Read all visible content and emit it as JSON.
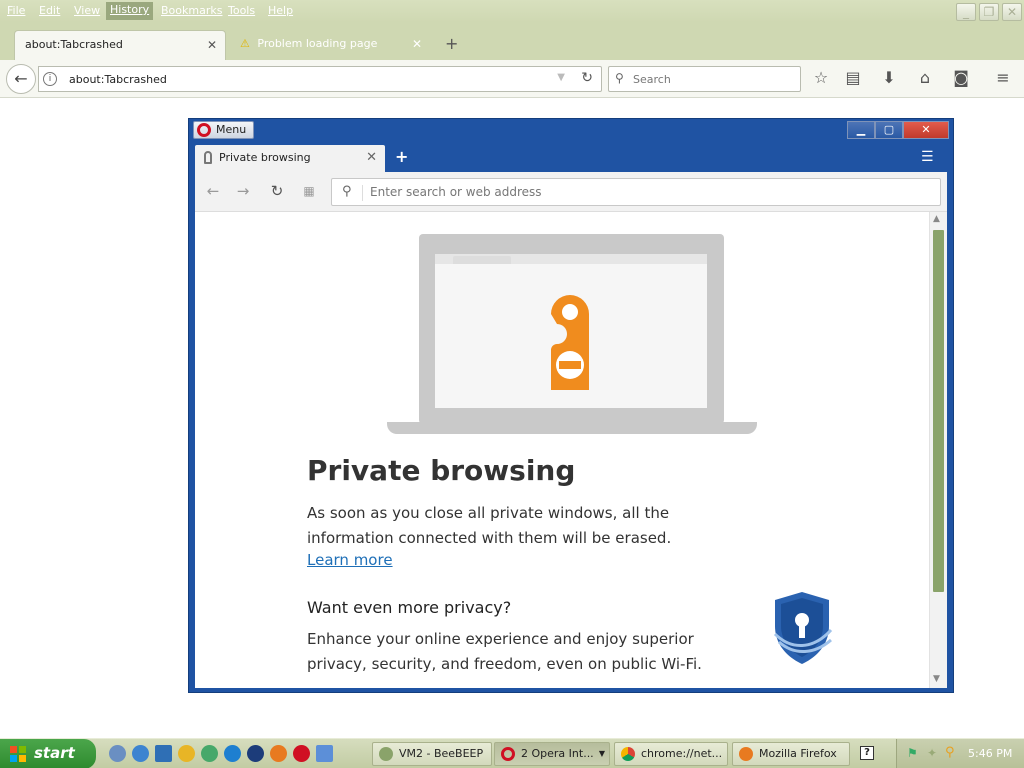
{
  "menubar": {
    "items": [
      "File",
      "Edit",
      "View",
      "History",
      "Bookmarks",
      "Tools",
      "Help"
    ]
  },
  "firefox": {
    "tabs": [
      {
        "label": "about:Tabcrashed",
        "active": true
      },
      {
        "label": "Problem loading page",
        "active": false,
        "icon": "warning-icon"
      }
    ],
    "url": "about:Tabcrashed",
    "search_placeholder": "Search",
    "toolbar_icons": [
      "bookmark-star-icon",
      "reading-list-icon",
      "downloads-icon",
      "home-icon",
      "pocket-icon",
      "hamburger-menu-icon"
    ]
  },
  "opera": {
    "menu_label": "Menu",
    "tab_label": "Private browsing",
    "address_placeholder": "Enter search or web address",
    "page": {
      "title": "Private browsing",
      "description": "As soon as you close all private windows, all the information connected with them will be erased.",
      "learn_more": "Learn more",
      "more_privacy_heading": "Want even more privacy?",
      "more_privacy_text": "Enhance your online experience and enjoy superior privacy, security, and freedom, even on public Wi-Fi."
    }
  },
  "taskbar": {
    "start_label": "start",
    "tasks": [
      {
        "label": "VM2 - BeeBEEP",
        "icon": "beebeep-icon"
      },
      {
        "label": "2 Opera Int...",
        "icon": "opera-icon",
        "active": true
      },
      {
        "label": "chrome://net...",
        "icon": "chrome-icon"
      },
      {
        "label": "Mozilla Firefox",
        "icon": "firefox-icon"
      }
    ],
    "clock": "5:46 PM"
  },
  "colors": {
    "opera_frame": "#1f53a3",
    "opera_close": "#c13a2c",
    "illustration_orange": "#f08c1e",
    "link_blue": "#1e6fb7",
    "start_green": "#2e8a2e"
  }
}
